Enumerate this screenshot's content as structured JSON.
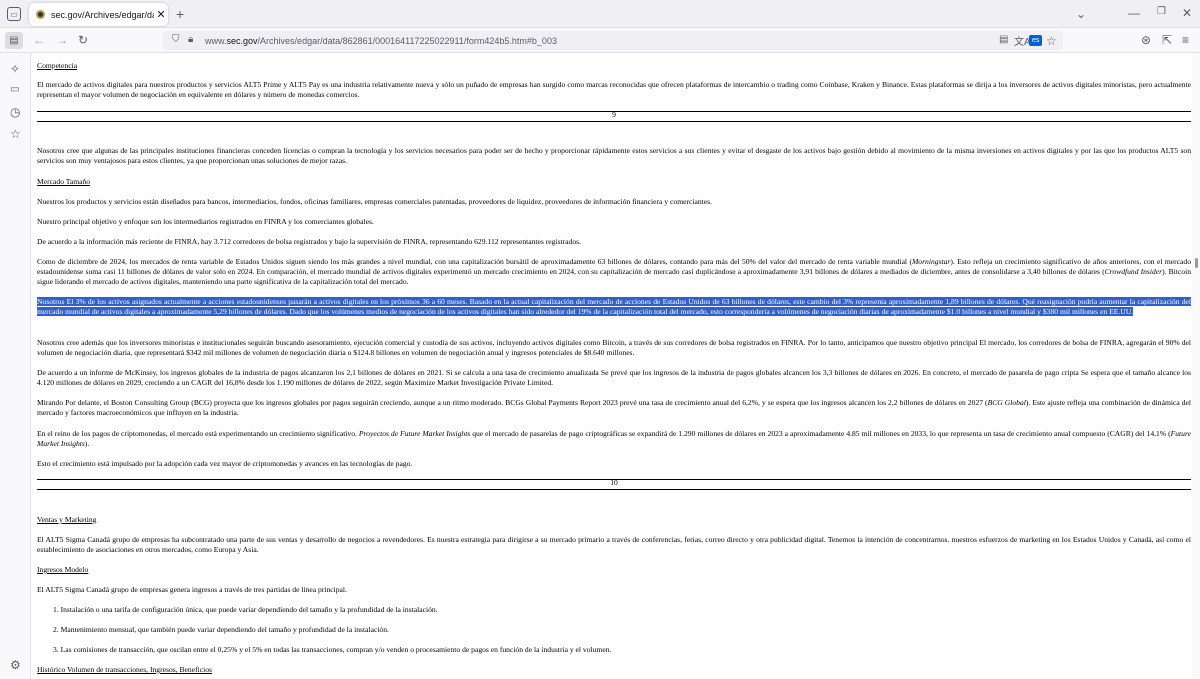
{
  "browser": {
    "tab_title": "sec.gov/Archives/edgar/data/8€",
    "url_prefix": "www.",
    "url_domain": "sec.gov",
    "url_path": "/Archives/edgar/data/862861/000164117225022911/form424b5.htm#b_003",
    "translate_badge": "es"
  },
  "doc": {
    "competencia_heading": "Competencia",
    "competencia_p": "El mercado de activos digitales para nuestros productos y servicios ALT5 Prime y ALT5 Pay es una industria relativamente nueva y sólo un puñado de empresas han surgido como marcas reconocidas que ofrecen plataformas de intercambio o trading como Coinbase, Kraken y Binance. Estas plataformas se dirija a los inversores de activos digitales minoristas, pero actualmente representan el mayor volumen de negociación en equivalente en dólares y número de monedas comercios.",
    "page9": "9",
    "p_nosotros1": "Nosotros cree que algunas de las principales instituciones financieras conceden licencias o compran la tecnología y los servicios necesarios para poder ser de hecho y proporcionar rápidamente estos servicios a sus clientes y evitar el desgaste de los activos bajo gestión debido al movimiento de la misma inversiones en activos digitales y por las que los productos ALT5 son servicios son muy ventajosos para estos clientes, ya que proporcionan unas soluciones de mejor razas.",
    "mercado_heading": "Mercado Tamaño",
    "p_productos": "Nuestros los productos y servicios están diseñados para bancos, intermediarios, fondos, oficinas familiares, empresas comerciales patentadas, proveedores de liquidez, proveedores de información financiera y comerciantes.",
    "p_objetivo": "Nuestro principal objetivo y enfoque son los intermediarios registrados en FINRA y los comerciantes globales.",
    "p_finra": "De acuerdo a la información más reciente de FINRA, hay 3.712 corredores de bolsa registrados y bajo la supervisión de FINRA, representando 629.112 representantes registrados.",
    "p_dic_a": "Como de diciembre de 2024, los mercados de renta variable de Estados Unidos siguen siendo los más grandes a nivel mundial, con una capitalización bursátil de aproximadamente 63 billones de dólares, contando para más del 50% del valor del mercado de renta variable mundial (",
    "p_dic_b": "Morningstar",
    "p_dic_c": "). Esto refleja un crecimiento significativo de años anteriores, con el mercado estadounidense suma casi 11 billones de dólares de valor solo en 2024. En comparación, el mercado mundial de activos digitales experimentó un mercado crecimiento en 2024, con su capitalización de mercado casi duplicándose a aproximadamente 3,91 billones de dólares a mediados de diciembre, antes de consolidarse a 3,40 billones de dólares (",
    "p_dic_d": "Crowdfund Insider",
    "p_dic_e": "). Bitcoin sigue liderando el mercado de activos digitales, manteniendo una parte significativa de la capitalización total del mercado.",
    "p_highlight": "Nosotros El 3% de los activos asignados actualmente a acciones estadounidenses pasarán a activos digitales en los próximos 36 a 60 meses. Basado en la actual capitalización del mercado de acciones de Estados Unidos de 63 billones de dólares, este cambio del 3% representa aproximadamente 1,89 billones de dólares. Qué reasignación podría aumentar la capitalización del mercado mundial de activos digitales a aproximadamente 5,29 billones de dólares. Dado que los volúmenes medios de negociación de los activos digitales han sido alrededor del 19% de la capitalización total del mercado, esto correspondería a volúmenes de negociación diarias de aproximadamente $1.0 billones a nivel mundial y $380 mil millones en EE.UU.",
    "p_nosotros2": "Nosotros cree además que los inversores minoristas e institucionales seguirán buscando asesoramiento, ejecución comercial y custodia de sus activos, incluyendo activos digitales como Bitcoin, a través de sus corredores de bolsa registrados en FINRA. Por lo tanto, anticipamos que nuestro objetivo principal El mercado, los corredores de bolsa de FINRA, agregarán el 90% del volumen de negociación diaria, que representará $342 mil millones de volumen de negociación diaria o $124.8 billones en volumen de negociación anual y ingresos potenciales de $8.640 millones.",
    "p_mckinsey": "De acuerdo a un informe de McKinsey, los ingresos globales de la industria de pagos alcanzaron los 2,1 billones de dólares en 2021. Si se calcula a una tasa de crecimiento anualizada Se prevé que los ingresos de la industria de pagos globales alcancen los 3,3 billones de dólares en 2026. En concreto, el mercado de pasarela de pago cripta Se espera que el tamaño alcance los 4.120 millones de dólares en 2029, creciendo a un CAGR del 16,8% desde los 1.190 millones de dólares de 2022, según Maximize Market Investigación Private Limited.",
    "p_bcg_a": "Mirando Por delante, el Boston Consulting Group (BCG) proyecta que los ingresos globales por pagos seguirán creciendo, aunque a un ritmo moderado. BCGs Global Payments Report 2023 prevé una tasa de crecimiento anual del 6,2%, y se espera que los ingresos alcancen los 2,2 billones de dólares en 2027 (",
    "p_bcg_b": "BCG Global",
    "p_bcg_c": "). Este ajuste refleja una combinación de dinámica del mercado y factores macroeconómicos que influyen en la industria.",
    "p_cripto_a": "En el reino de los pagos de criptomonedas, el mercado está experimentando un crecimiento significativo. ",
    "p_cripto_b": "Proyectos de Future Market Insights",
    "p_cripto_c": " que el mercado de pasarelas de pago criptográficas se expandirá de 1.290 millones de dólares en 2023 a aproximadamente 4.85 mil millones en 2033, lo que representa un tasa de crecimiento anual compuesto (CAGR) del 14,1% (",
    "p_cripto_d": "Future Market Insights",
    "p_cripto_e": ").",
    "p_esto": "Esto el crecimiento está impulsado por la adopción cada vez mayor de criptomonedas y avances en las tecnologías de pago.",
    "page10": "10",
    "ventas_heading": "Ventas y Marketing",
    "p_ventas": "El ALT5 Sigma Canadá grupo de empresas ha subcontratado una parte de sus ventas y desarrollo de negocios a revendedores. Es nuestra estrategia para dirigirse a su mercado primario a través de conferencias, ferias, correo directo y otra publicidad digital. Tenemos la intención de concentrarnos. nuestros esfuerzos de marketing en los Estados Unidos y Canadá, así como el establecimiento de asociaciones en otros mercados, como Europa y Asia.",
    "ingresos_heading": "Ingresos Modelo",
    "p_ingresos": "El ALT5 Sigma Canadá grupo de empresas genera ingresos a través de tres partidas de línea principal.",
    "li1": "1. Instalación o una tarifa de configuración única, que puede variar dependiendo del tamaño y la profundidad de la instalación.",
    "li2": "2. Mantenimiento mensual, que también puede variar dependiendo del tamaño y profundidad de la instalación.",
    "li3": "3. Las comisiones de transacción, que oscilan entre el 0,25% y el 5% en todas las transacciones, compran y/o venden o procesamiento de pagos en función de la industria y el volumen.",
    "historico_heading": "Histórico Volumen de transacciones, Ingresos, Beneficios"
  }
}
